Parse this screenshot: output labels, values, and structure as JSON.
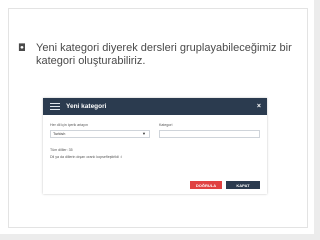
{
  "slide": {
    "bullet_text": "Yeni kategori diyerek dersleri gruplayabileceğimiz bir kategori oluşturabiliriz."
  },
  "modal": {
    "title": "Yeni kategori",
    "close_symbol": "×",
    "language_label": "Her dil için içerik ariayın",
    "language_value": "Turkish",
    "category_label": "Kategori",
    "all_lessons_label": "Tüm dilller: 35",
    "description": "Dil ya da dillerin dışarı oranlı kopsefleştirildi :i",
    "confirm_button": "DOĞRULA",
    "close_button": "KAPAT"
  },
  "colors": {
    "header_bg": "#2b3b4f",
    "confirm_bg": "#e04141",
    "close_bg": "#2b3b4f"
  },
  "icons": [
    "bullet-icon",
    "menu-icon",
    "close-icon",
    "dropdown-caret-icon"
  ]
}
